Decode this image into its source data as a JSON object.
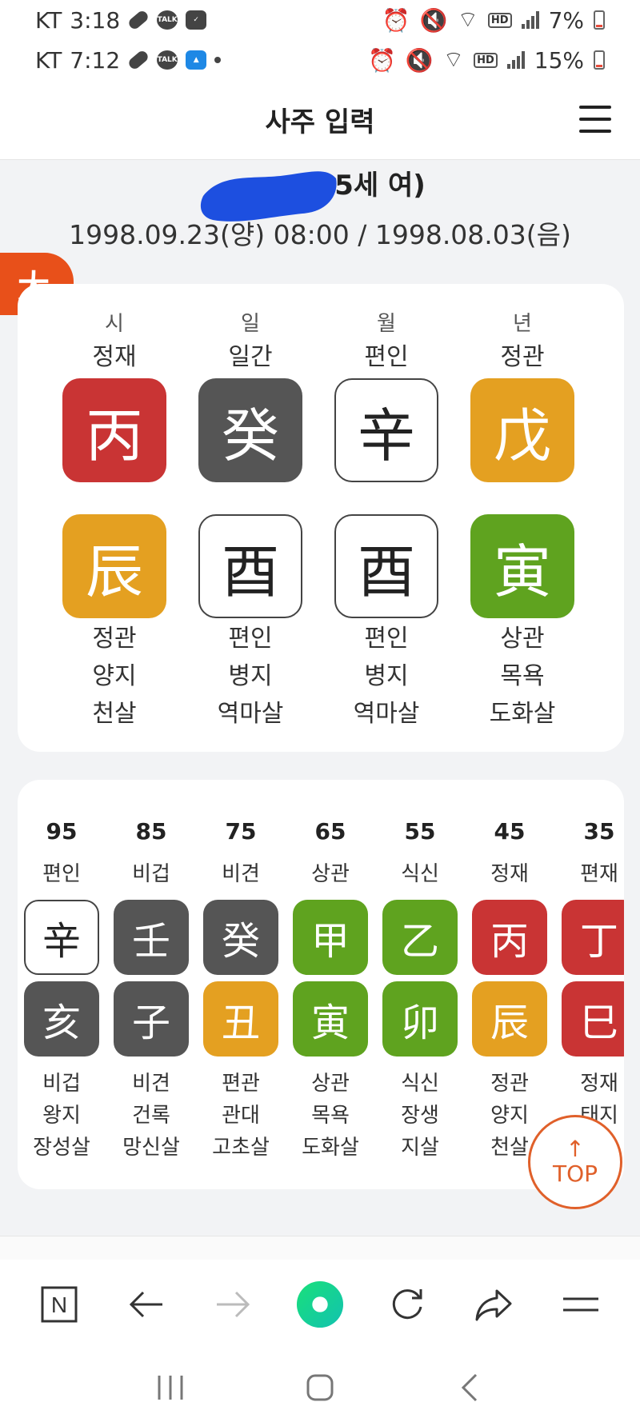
{
  "status_top": {
    "carrier": "KT",
    "time": "3:18",
    "battery": "7%"
  },
  "status_bottom": {
    "carrier": "KT",
    "time": "7:12",
    "battery": "15%"
  },
  "header": {
    "title": "사주 입력"
  },
  "person": {
    "name_suffix": "5세 여)",
    "dates": "1998.09.23(양) 08:00 / 1998.08.03(음)"
  },
  "big_badge": "大",
  "pillars": [
    {
      "pos": "시",
      "rel": "정재",
      "stem": "丙",
      "stem_color": "#c93434",
      "branch": "辰",
      "branch_color": "#e4a021",
      "b_rel": "정관",
      "b_stage": "양지",
      "b_sal": "천살"
    },
    {
      "pos": "일",
      "rel": "일간",
      "stem": "癸",
      "stem_color": "#555555",
      "branch": "酉",
      "branch_color": "#ffffff",
      "b_rel": "편인",
      "b_stage": "병지",
      "b_sal": "역마살"
    },
    {
      "pos": "월",
      "rel": "편인",
      "stem": "辛",
      "stem_color": "#ffffff",
      "branch": "酉",
      "branch_color": "#ffffff",
      "b_rel": "편인",
      "b_stage": "병지",
      "b_sal": "역마살"
    },
    {
      "pos": "년",
      "rel": "정관",
      "stem": "戊",
      "stem_color": "#e4a021",
      "branch": "寅",
      "branch_color": "#5fa31f",
      "b_rel": "상관",
      "b_stage": "목욕",
      "b_sal": "도화살"
    }
  ],
  "daeun": [
    {
      "age": "95",
      "rel": "편인",
      "stem": "辛",
      "stem_color": "#ffffff",
      "branch": "亥",
      "branch_color": "#555555",
      "b_rel": "비겁",
      "b_stage": "왕지",
      "b_sal": "장성살"
    },
    {
      "age": "85",
      "rel": "비겁",
      "stem": "壬",
      "stem_color": "#555555",
      "branch": "子",
      "branch_color": "#555555",
      "b_rel": "비견",
      "b_stage": "건록",
      "b_sal": "망신살"
    },
    {
      "age": "75",
      "rel": "비견",
      "stem": "癸",
      "stem_color": "#555555",
      "branch": "丑",
      "branch_color": "#e4a021",
      "b_rel": "편관",
      "b_stage": "관대",
      "b_sal": "고초살"
    },
    {
      "age": "65",
      "rel": "상관",
      "stem": "甲",
      "stem_color": "#5fa31f",
      "branch": "寅",
      "branch_color": "#5fa31f",
      "b_rel": "상관",
      "b_stage": "목욕",
      "b_sal": "도화살"
    },
    {
      "age": "55",
      "rel": "식신",
      "stem": "乙",
      "stem_color": "#5fa31f",
      "branch": "卯",
      "branch_color": "#5fa31f",
      "b_rel": "식신",
      "b_stage": "장생",
      "b_sal": "지살"
    },
    {
      "age": "45",
      "rel": "정재",
      "stem": "丙",
      "stem_color": "#c93434",
      "branch": "辰",
      "branch_color": "#e4a021",
      "b_rel": "정관",
      "b_stage": "양지",
      "b_sal": "천살"
    },
    {
      "age": "35",
      "rel": "편재",
      "stem": "丁",
      "stem_color": "#c93434",
      "branch": "巳",
      "branch_color": "#c93434",
      "b_rel": "정재",
      "b_stage": "태지",
      "b_sal": ""
    }
  ],
  "top_button": {
    "arrow": "↑",
    "label": "TOP"
  }
}
